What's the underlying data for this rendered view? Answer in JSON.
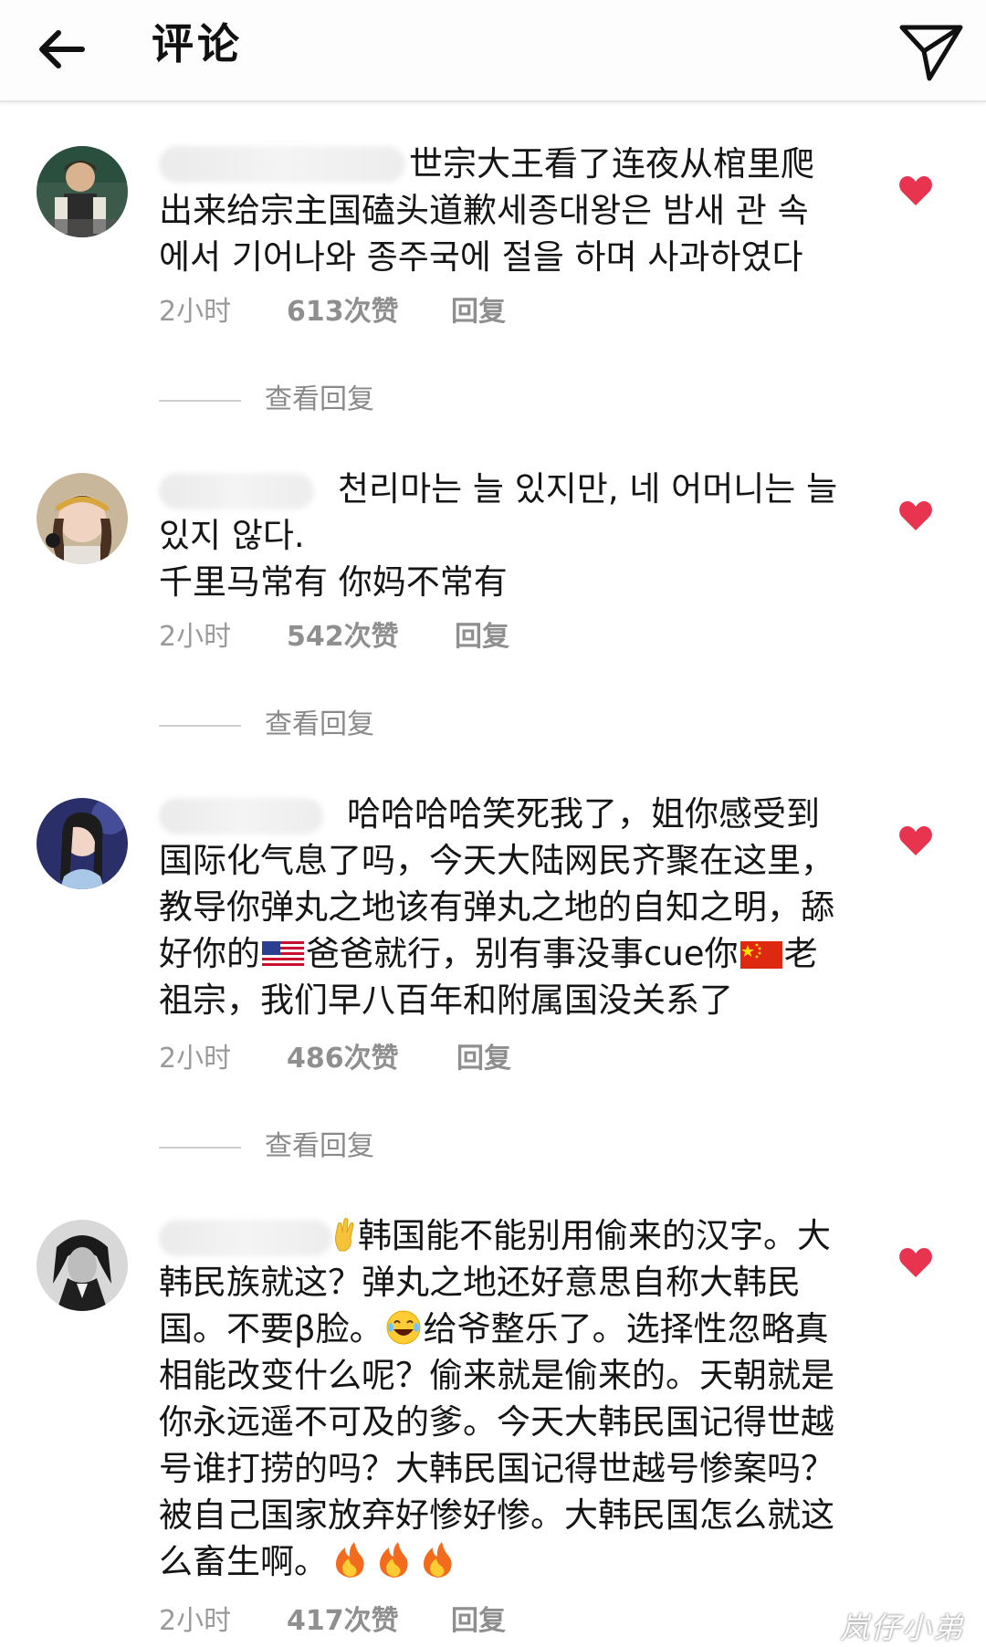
{
  "header": {
    "title": "评论",
    "back_icon": "arrow-left-icon",
    "send_icon": "paper-plane-icon"
  },
  "comments": [
    {
      "text_line1": "世宗大王看了连夜从棺里爬",
      "text_rest": "出来给宗主国磕头道歉세종대왕은 밤새 관 속\n에서 기어나와 종주국에 절을 하며 사과하였다",
      "time": "2小时",
      "likes": "613次赞",
      "reply": "回复",
      "view_replies": "查看回复"
    },
    {
      "text_line1": "천리마는 늘 있지만, 네 어머니는 늘",
      "text_rest": "있지 않다.\n千里马常有 你妈不常有",
      "time": "2小时",
      "likes": "542次赞",
      "reply": "回复",
      "view_replies": "查看回复"
    },
    {
      "text_line1": "哈哈哈哈笑死我了，姐你感受到",
      "text_line2": "国际化气息了吗，今天大陆网民齐聚在这里，",
      "text_line3": "教导你弹丸之地该有弹丸之地的自知之明，舔",
      "text_line4a": "好你的",
      "text_line4b": "爸爸就行，别有事没事cue你",
      "text_line4c": "老",
      "text_line5": "祖宗，我们早八百年和附属国没关系了",
      "time": "2小时",
      "likes": "486次赞",
      "reply": "回复",
      "view_replies": "查看回复"
    },
    {
      "text_line1": "韩国能不能别用偷来的汉字。大",
      "text_line2": "韩民族就这？弹丸之地还好意思自称大韩民",
      "text_line3a": "国。不要β脸。",
      "text_line3b": "给爷整乐了。选择性忽略真",
      "text_line4": "相能改变什么呢？偷来就是偷来的。天朝就是",
      "text_line5": "你永远遥不可及的爹。今天大韩民国记得世越",
      "text_line6": "号谁打捞的吗？大韩民国记得世越号惨案吗？",
      "text_line7": "被自己国家放弃好惨好惨。大韩民国怎么就这",
      "text_line8": "么畜生啊。",
      "time": "2小时",
      "likes": "417次赞",
      "reply": "回复"
    }
  ],
  "watermark": "岚仔小弟",
  "colors": {
    "heart": "#e8344e",
    "meta_text": "#9a9a9a",
    "background": "#ffffff"
  }
}
